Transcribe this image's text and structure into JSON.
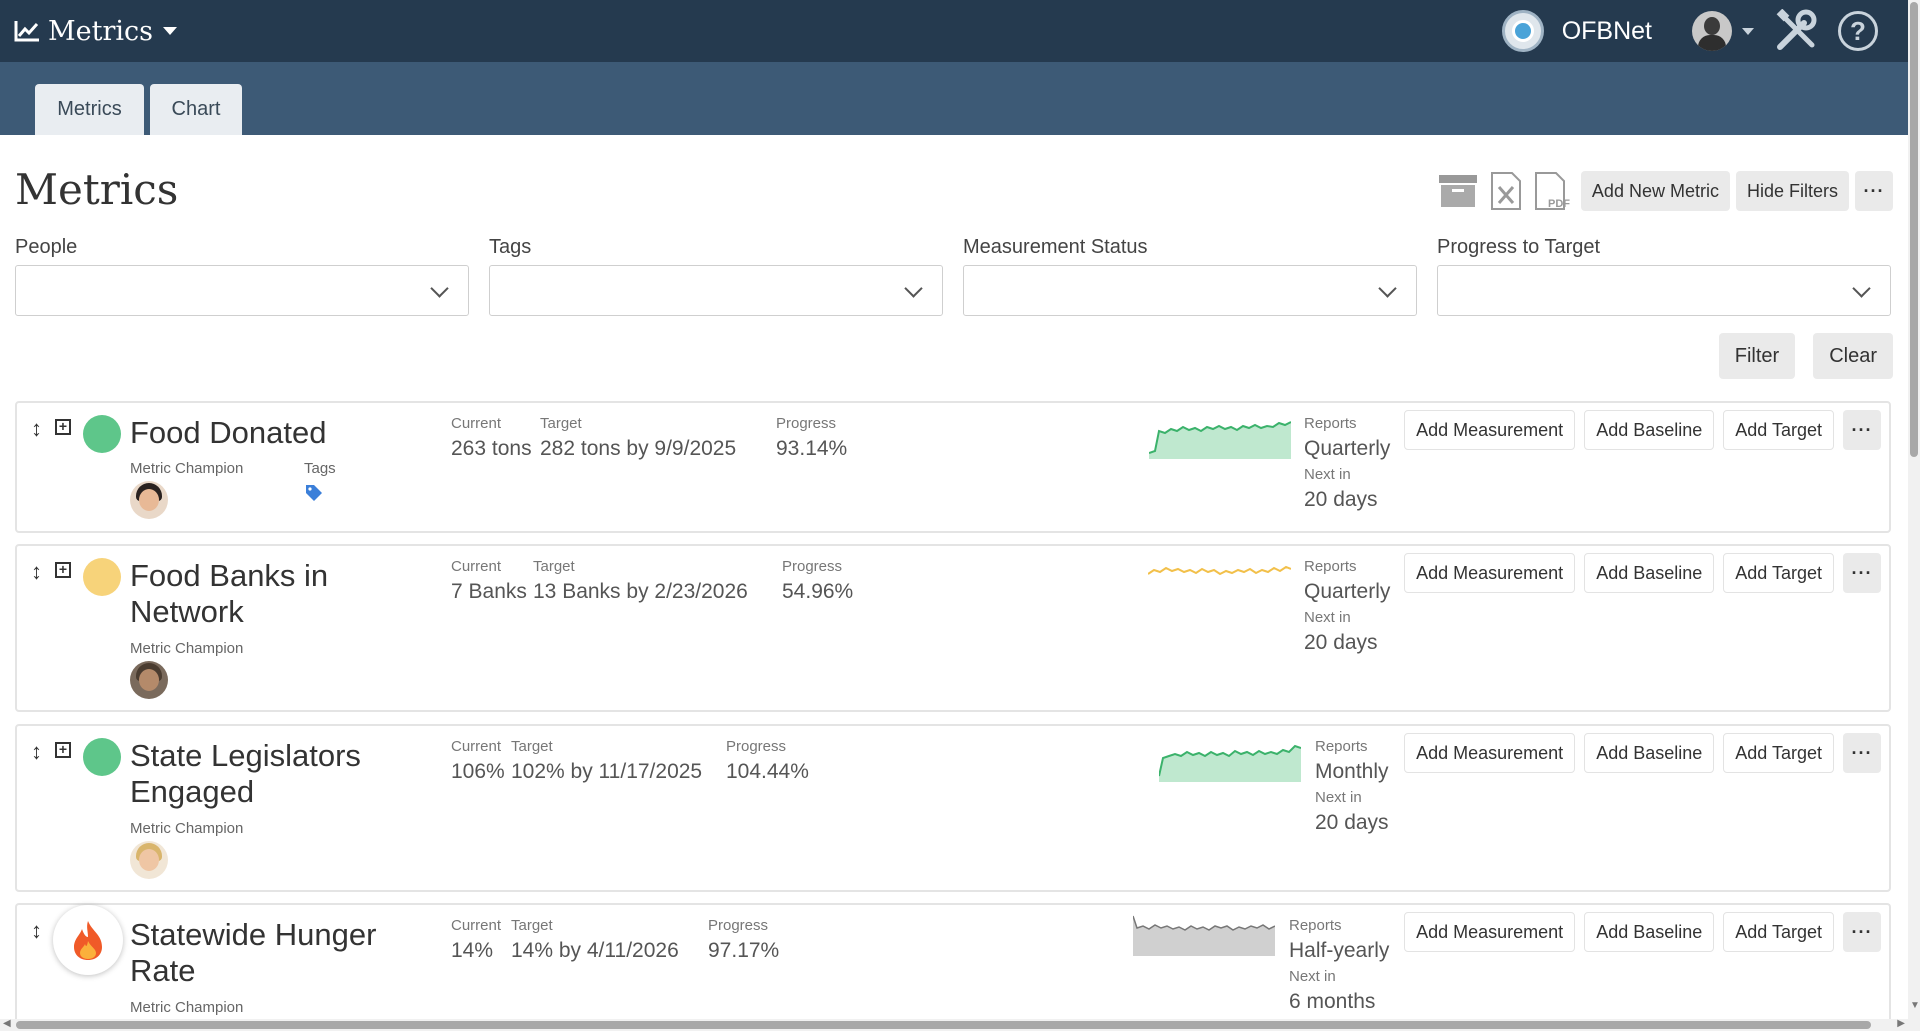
{
  "topbar": {
    "app_title": "Metrics",
    "org_name": "OFBNet",
    "icons": [
      "line-chart-icon",
      "org-logo",
      "user-avatar",
      "tools-icon",
      "help-icon"
    ]
  },
  "tabs": [
    {
      "label": "Metrics",
      "active": true
    },
    {
      "label": "Chart",
      "active": false
    }
  ],
  "page": {
    "title": "Metrics",
    "toolbar": {
      "add_new_metric": "Add New Metric",
      "hide_filters": "Hide Filters",
      "more": "···"
    }
  },
  "filters": {
    "people_label": "People",
    "tags_label": "Tags",
    "measurement_status_label": "Measurement Status",
    "progress_label": "Progress to Target",
    "filter_button": "Filter",
    "clear_button": "Clear"
  },
  "labels": {
    "current": "Current",
    "target": "Target",
    "progress": "Progress",
    "reports": "Reports",
    "next_in": "Next in",
    "metric_champion": "Metric Champion",
    "tags": "Tags",
    "add_measurement": "Add Measurement",
    "add_baseline": "Add Baseline",
    "add_target": "Add Target",
    "more": "···"
  },
  "colors": {
    "green": "#5ec68a",
    "yellow": "#f7d37a",
    "gray_spark": "#bdbdbd",
    "topbar": "#253a4f",
    "subnav": "#3d5a76"
  },
  "metrics": [
    {
      "name": "Food Donated",
      "status": "green",
      "current": "263 tons",
      "target": "282 tons by 9/9/2025",
      "progress": "93.14%",
      "reports": "Quarterly",
      "next_in": "20 days",
      "has_tags": true
    },
    {
      "name": "Food Banks in Network",
      "status": "yellow",
      "current": "7 Banks",
      "target": "13 Banks by 2/23/2026",
      "progress": "54.96%",
      "reports": "Quarterly",
      "next_in": "20 days",
      "has_tags": false
    },
    {
      "name": "State Legislators Engaged",
      "status": "green",
      "current": "106%",
      "target": "102% by 11/17/2025",
      "progress": "104.44%",
      "reports": "Monthly",
      "next_in": "20 days",
      "has_tags": false
    },
    {
      "name": "Statewide Hunger Rate",
      "status": "fire",
      "current": "14%",
      "target": "14% by 4/11/2026",
      "progress": "97.17%",
      "reports": "Half-yearly",
      "next_in": "6 months",
      "has_tags": false
    }
  ]
}
